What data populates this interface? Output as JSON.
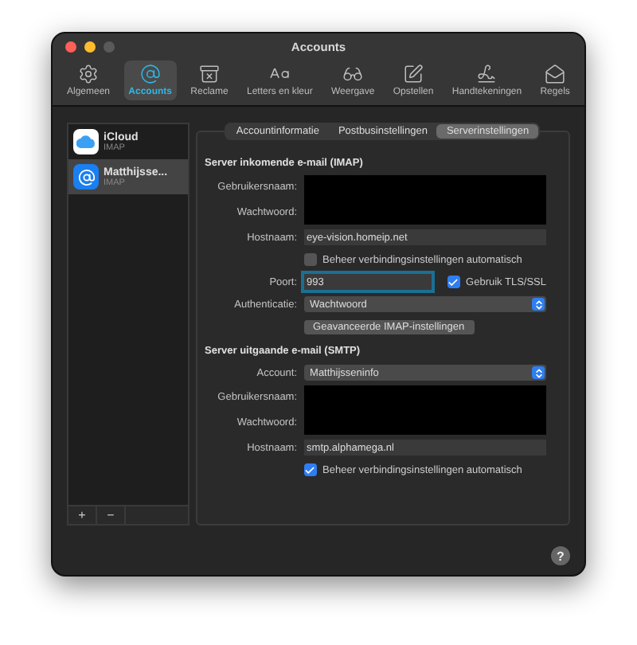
{
  "window": {
    "title": "Accounts"
  },
  "toolbar": [
    {
      "kind": "gear",
      "label": "Algemeen",
      "selected": false
    },
    {
      "kind": "at",
      "label": "Accounts",
      "selected": true
    },
    {
      "kind": "junk",
      "label": "Reclame",
      "selected": false
    },
    {
      "kind": "fonts",
      "label": "Letters en kleur",
      "selected": false
    },
    {
      "kind": "glasses",
      "label": "Weergave",
      "selected": false
    },
    {
      "kind": "compose",
      "label": "Opstellen",
      "selected": false
    },
    {
      "kind": "signature",
      "label": "Handtekeningen",
      "selected": false
    },
    {
      "kind": "rules",
      "label": "Regels",
      "selected": false
    }
  ],
  "accounts": [
    {
      "kind": "icloud",
      "name": "iCloud",
      "type": "IMAP",
      "selected": false
    },
    {
      "kind": "at",
      "name": "Matthijsse...",
      "type": "IMAP",
      "selected": true
    }
  ],
  "sidebar_buttons": [
    "+",
    "−"
  ],
  "tabs": [
    {
      "label": "Accountinformatie",
      "selected": false
    },
    {
      "label": "Postbusinstellingen",
      "selected": false
    },
    {
      "label": "Serverinstellingen",
      "selected": true
    }
  ],
  "sections": [
    {
      "title": "Server inkomende e-mail (IMAP)",
      "rows": [
        {
          "kind": "redacted",
          "labels": [
            "Gebruikersnaam:",
            "Wachtwoord:"
          ]
        },
        {
          "kind": "text",
          "label": "Hostnaam:",
          "value": "eye-vision.homeip.net"
        },
        {
          "kind": "checkbox",
          "label": "Beheer verbindingsinstellingen automatisch",
          "checked": false
        },
        {
          "kind": "port",
          "label": "Poort:",
          "value": "993",
          "focused": true,
          "check_label": "Gebruik TLS/SSL",
          "checked": true
        },
        {
          "kind": "select",
          "label": "Authenticatie:",
          "value": "Wachtwoord"
        },
        {
          "kind": "button",
          "label": "Geavanceerde IMAP-instellingen"
        }
      ]
    },
    {
      "title": "Server uitgaande e-mail (SMTP)",
      "rows": [
        {
          "kind": "select",
          "label": "Account:",
          "value": "Matthijsseninfo"
        },
        {
          "kind": "redacted",
          "labels": [
            "Gebruikersnaam:",
            "Wachtwoord:"
          ]
        },
        {
          "kind": "text",
          "label": "Hostnaam:",
          "value": "smtp.alphamega.nl"
        },
        {
          "kind": "checkbox",
          "label": "Beheer verbindingsinstellingen automatisch",
          "checked": true
        }
      ]
    }
  ],
  "help": "?"
}
